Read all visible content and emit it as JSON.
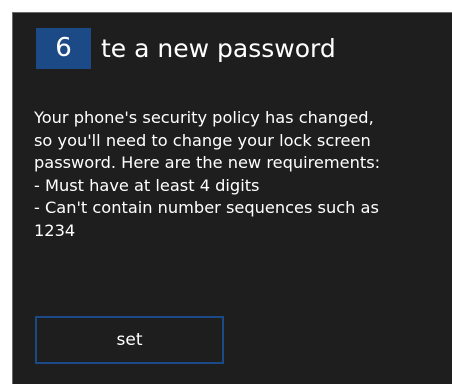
{
  "dialog": {
    "badge_number": "6",
    "title": "te a new password",
    "message_lines": [
      "Your phone's security policy has changed,",
      "so you'll need to change your lock screen",
      "password. Here are the new requirements:",
      "- Must have at least 4 digits",
      "- Can't contain number sequences such as",
      "1234"
    ],
    "set_label": "set"
  },
  "colors": {
    "background": "#1e1e1e",
    "accent": "#1c4a86",
    "text": "#ffffff"
  }
}
